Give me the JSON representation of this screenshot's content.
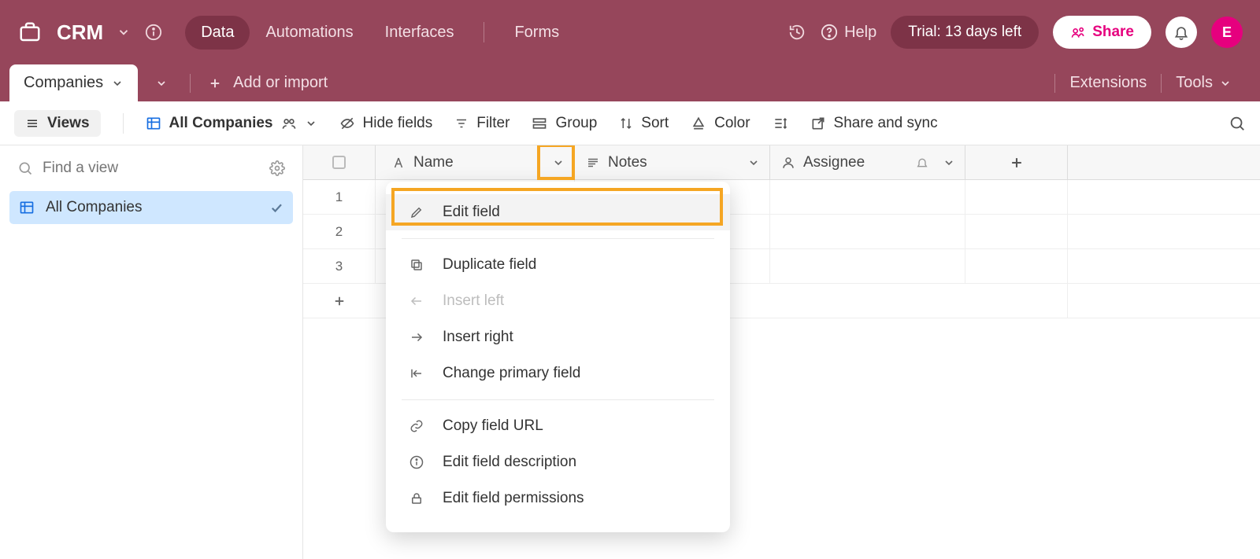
{
  "header": {
    "app_title": "CRM",
    "nav": {
      "data": "Data",
      "automations": "Automations",
      "interfaces": "Interfaces",
      "forms": "Forms"
    },
    "help": "Help",
    "trial": "Trial: 13 days left",
    "share": "Share",
    "avatar_initial": "E"
  },
  "tabbar": {
    "active_tab": "Companies",
    "add_or_import": "Add or import",
    "extensions": "Extensions",
    "tools": "Tools"
  },
  "toolbar": {
    "views": "Views",
    "all_companies": "All Companies",
    "hide_fields": "Hide fields",
    "filter": "Filter",
    "group": "Group",
    "sort": "Sort",
    "color": "Color",
    "share_sync": "Share and sync"
  },
  "sidebar": {
    "find_placeholder": "Find a view",
    "view0": "All Companies"
  },
  "grid": {
    "columns": {
      "name": "Name",
      "notes": "Notes",
      "assignee": "Assignee"
    },
    "rows": [
      "1",
      "2",
      "3"
    ]
  },
  "dropdown": {
    "edit_field": "Edit field",
    "duplicate_field": "Duplicate field",
    "insert_left": "Insert left",
    "insert_right": "Insert right",
    "change_primary": "Change primary field",
    "copy_url": "Copy field URL",
    "edit_desc": "Edit field description",
    "edit_perm": "Edit field permissions"
  }
}
